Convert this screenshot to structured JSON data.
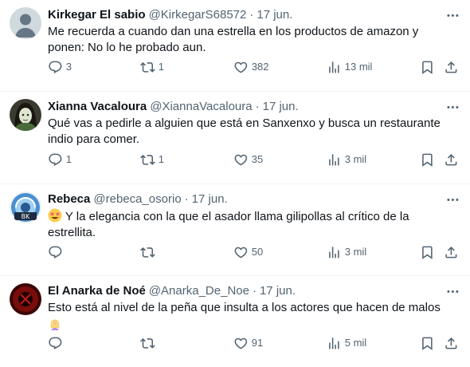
{
  "tweets": [
    {
      "name": "Kirkegar El sabio",
      "handle": "@KirkegarS68572",
      "separator": "·",
      "time": "17 jun.",
      "text": "Me recuerda a cuando dan una estrella en los productos de amazon y\nponen: No lo he probado aun.",
      "replies": "3",
      "retweets": "1",
      "likes": "382",
      "views": "13 mil"
    },
    {
      "name": "Xianna Vacaloura",
      "handle": "@XiannaVacaloura",
      "separator": "·",
      "time": "17 jun.",
      "text": "Qué vas a pedirle a alguien que está en Sanxenxo y busca un restaurante\nindio para comer.",
      "replies": "1",
      "retweets": "1",
      "likes": "35",
      "views": "3 mil"
    },
    {
      "name": "Rebeca",
      "handle": "@rebeca_osorio",
      "separator": "·",
      "time": "17 jun.",
      "text": " Y la elegancia con la que el asador llama gilipollas al crítico de la\nestrellita.",
      "leading_emoji": "star-struck-emoji",
      "replies": "",
      "retweets": "",
      "likes": "50",
      "views": "3 mil"
    },
    {
      "name": "El Anarka de Noé",
      "handle": "@Anarka_De_Noe",
      "separator": "·",
      "time": "17 jun.",
      "text": "Esto está al nivel de la peña que insulta a los actores que hacen de malos",
      "trailing_emoji": "woman-facepalming-emoji",
      "replies": "",
      "retweets": "",
      "likes": "91",
      "views": "5 mil"
    }
  ],
  "icons": {
    "reply": "reply-icon",
    "retweet": "retweet-icon",
    "like": "like-icon",
    "views": "views-icon",
    "bookmark": "bookmark-icon",
    "share": "share-icon",
    "more": "more-icon"
  },
  "colors": {
    "text": "#0f1419",
    "secondary": "#536471",
    "divider": "#eff3f4"
  }
}
